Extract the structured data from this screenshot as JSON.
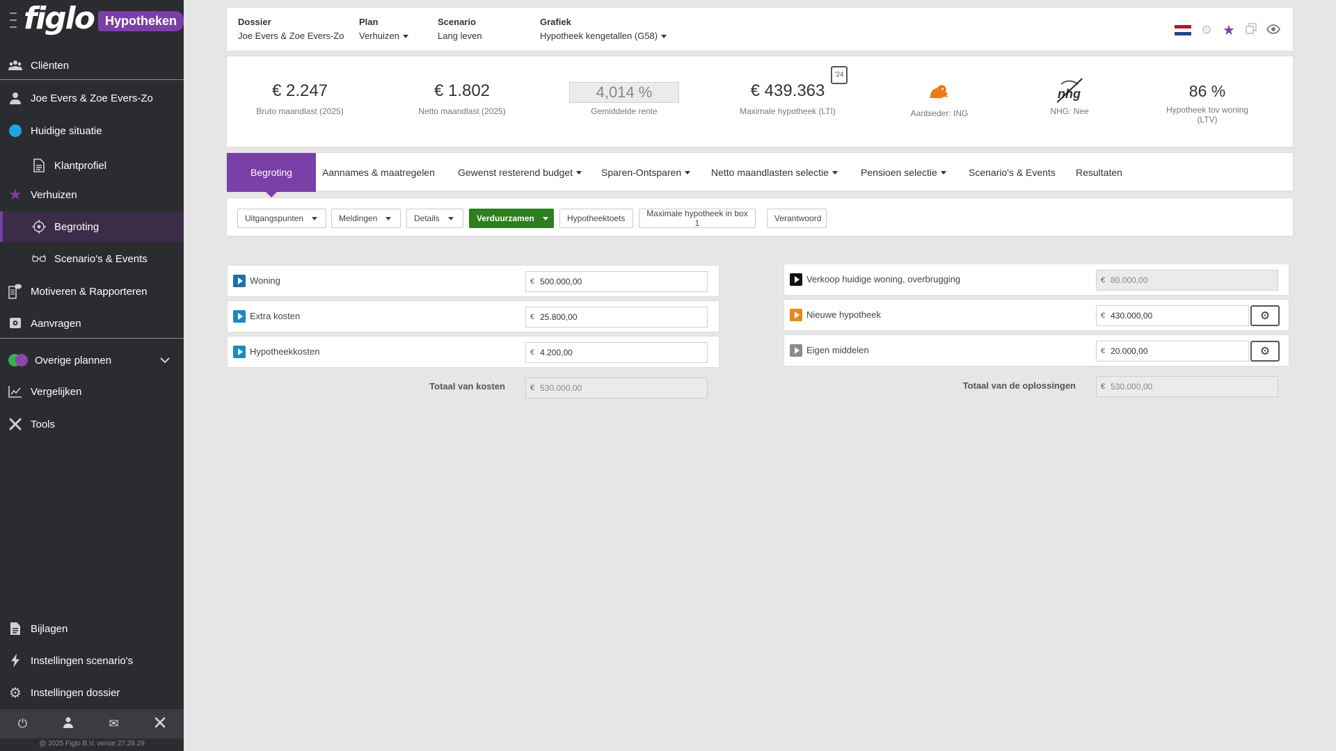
{
  "brand": {
    "logo": "figlo",
    "badge": "Hypotheken"
  },
  "sidebar": {
    "items": [
      {
        "label": "Cliënten",
        "icon": "users-icon"
      },
      {
        "label": "Joe Evers & Zoe Evers-Zo",
        "icon": "user-icon"
      },
      {
        "label": "Huidige situatie",
        "icon": "blue-dot-icon"
      },
      {
        "label": "Klantprofiel",
        "icon": "document-icon"
      },
      {
        "label": "Verhuizen",
        "icon": "star-icon"
      },
      {
        "label": "Begroting",
        "icon": "target-icon"
      },
      {
        "label": "Scenario's & Events",
        "icon": "glasses-icon"
      },
      {
        "label": "Motiveren & Rapporteren",
        "icon": "report-icon"
      },
      {
        "label": "Aanvragen",
        "icon": "safe-icon"
      },
      {
        "label": "Overige plannen",
        "icon": "duo-dots-icon"
      },
      {
        "label": "Vergelijken",
        "icon": "chart-line-icon"
      },
      {
        "label": "Tools",
        "icon": "tools-icon"
      },
      {
        "label": "Bijlagen",
        "icon": "file-icon"
      },
      {
        "label": "Instellingen scenario's",
        "icon": "bolt-icon"
      },
      {
        "label": "Instellingen dossier",
        "icon": "gear-icon"
      }
    ],
    "copyright": "@ 2025 Figlo B.V. versie 27.28.29"
  },
  "header": {
    "dossier_label": "Dossier",
    "dossier_value": "Joe Evers & Zoe Evers-Zo",
    "plan_label": "Plan",
    "plan_value": "Verhuizen",
    "scenario_label": "Scenario",
    "scenario_value": "Lang leven",
    "grafiek_label": "Grafiek",
    "grafiek_value": "Hypotheek kengetallen (G58)"
  },
  "kpis": {
    "bruto_value": "€ 2.247",
    "bruto_caption": "Bruto maandlast (2025)",
    "netto_value": "€ 1.802",
    "netto_caption": "Netto maandlast (2025)",
    "rente_value": "4,014 %",
    "rente_caption": "Gemiddelde rente",
    "max_value": "€ 439.363",
    "max_caption": "Maximale hypotheek (LTI)",
    "calendar_year": "'24",
    "aanbieder_caption": "Aanbieder: ING",
    "nhg_logo": "nhg",
    "nhg_caption": "NHG: Nee",
    "ltv_value": "86 %",
    "ltv_caption": "Hypotheek tov woning (LTV)"
  },
  "tabs": [
    "Begroting",
    "Aannames & maatregelen",
    "Gewenst resterend budget",
    "Sparen-Ontsparen",
    "Netto maandlasten selectie",
    "Pensioen selectie",
    "Scenario's & Events",
    "Resultaten"
  ],
  "subtabs": [
    "Uitgangspunten",
    "Meldingen",
    "Details",
    "Verduurzamen",
    "Hypotheektoets",
    "Maximale hypotheek in box 1",
    "Verantwoord"
  ],
  "costs": {
    "currency": "€",
    "rows": [
      {
        "label": "Woning",
        "value": "500.000,00"
      },
      {
        "label": "Extra kosten",
        "value": "25.800,00"
      },
      {
        "label": "Hypotheekkosten",
        "value": "4.200,00"
      }
    ],
    "total_label": "Totaal van kosten",
    "total_value": "530.000,00"
  },
  "solutions": {
    "rows": [
      {
        "label": "Verkoop huidige woning, overbrugging",
        "value": "80.000,00"
      },
      {
        "label": "Nieuwe hypotheek",
        "value": "430.000,00"
      },
      {
        "label": "Eigen middelen",
        "value": "20.000,00"
      }
    ],
    "total_label": "Totaal van de oplossingen",
    "total_value": "530.000,00"
  },
  "colors": {
    "accent": "#7b3fa8",
    "sidebar": "#2b2c30",
    "green": "#2e7d1f",
    "play_blue": "#1e88c7",
    "play_orange": "#e8891a",
    "play_grey": "#8a8a8a",
    "play_black": "#111111"
  }
}
